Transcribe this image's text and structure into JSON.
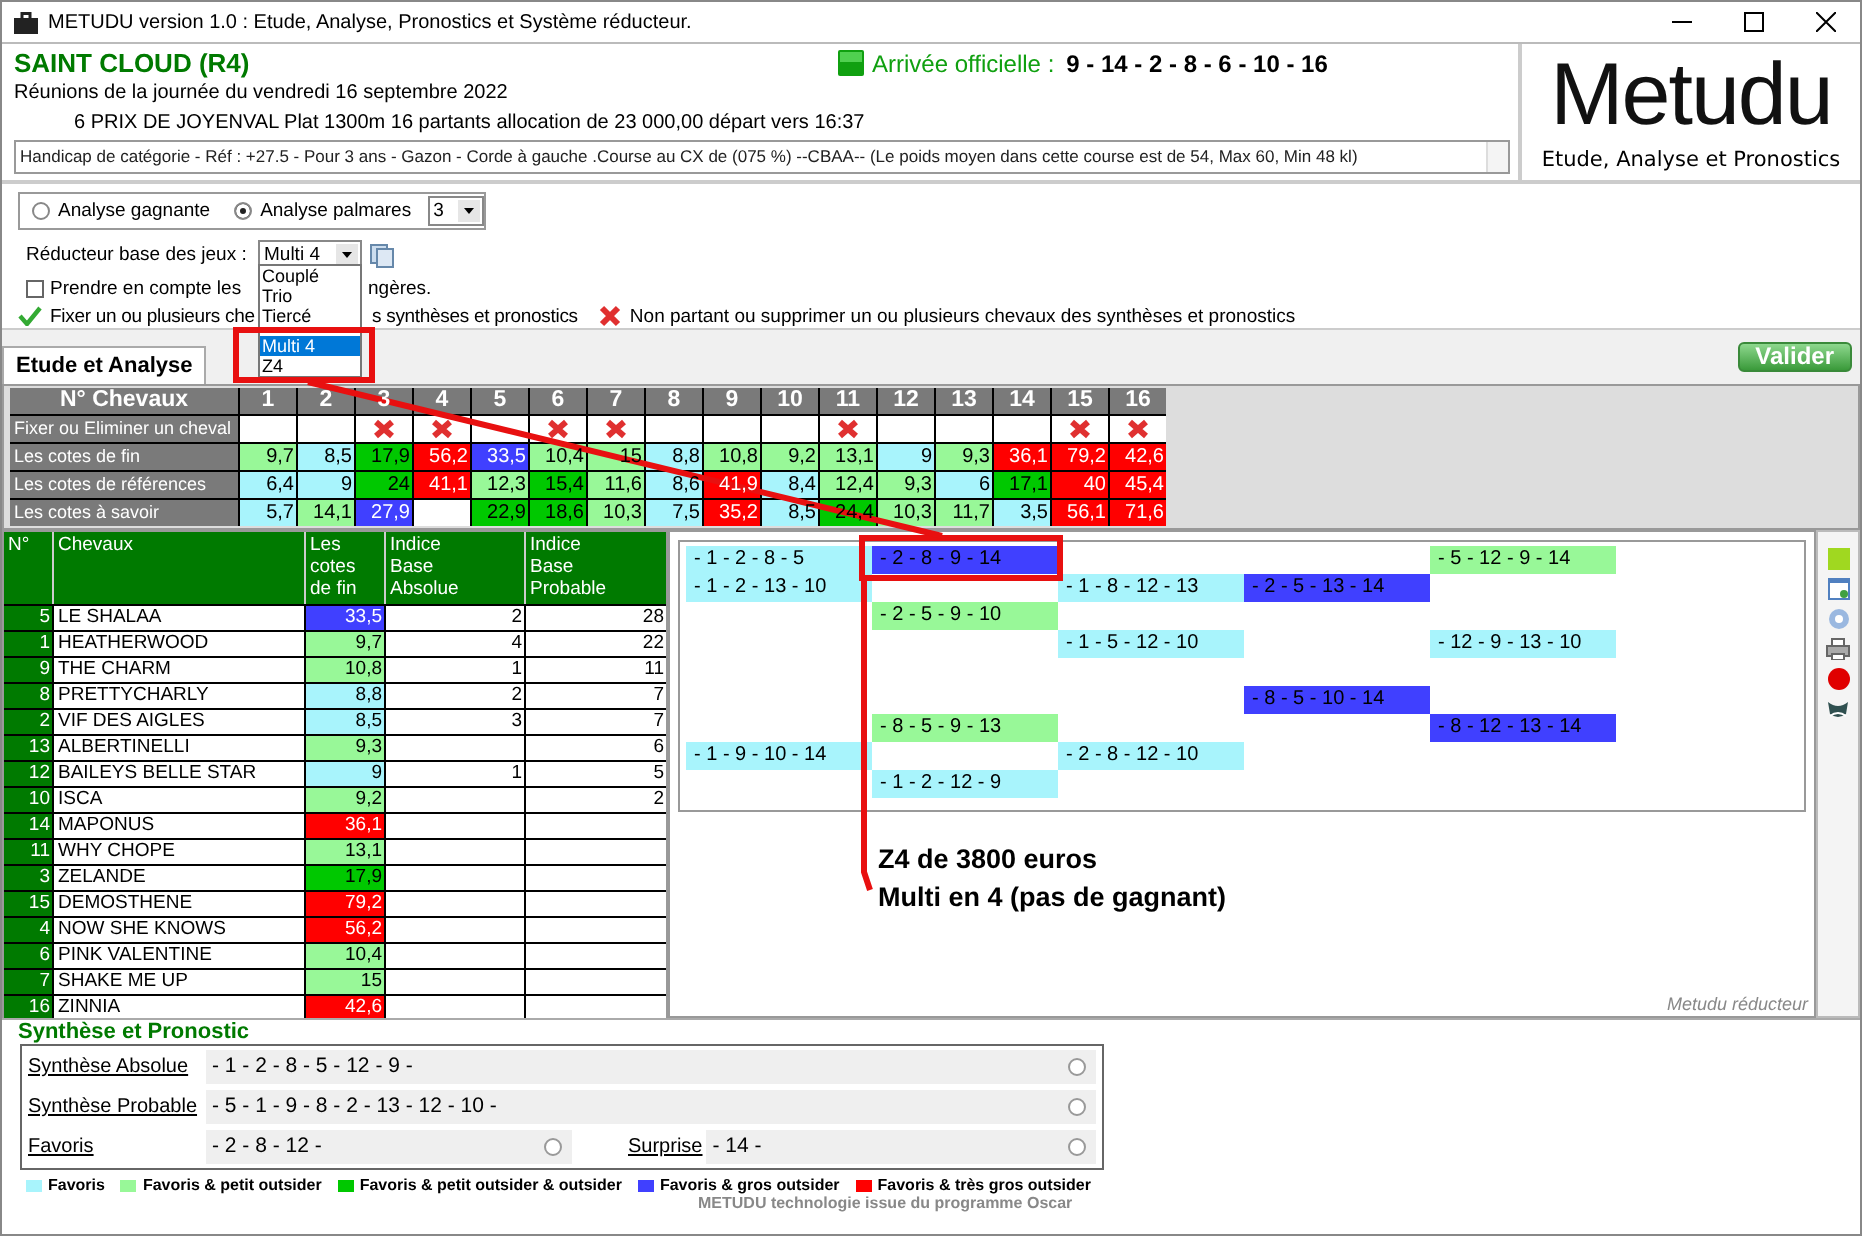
{
  "window": {
    "title": "METUDU version 1.0  : Etude, Analyse,  Pronostics et Système réducteur."
  },
  "race": {
    "venue": "SAINT CLOUD (R4)",
    "date_line": "Réunions de la journée du vendredi 16 septembre 2022",
    "race_line": "6 PRIX DE JOYENVAL Plat 1300m 16 partants allocation de 23 000,00 départ vers 16:37",
    "conditions": "Handicap de catégorie - Réf : +27.5 - Pour 3 ans - Gazon - Corde à gauche .Course au CX de (075 %)  --CBAA--  (Le poids moyen dans cette course est de 54, Max 60, Min 48 kl)",
    "arrival_label": "Arrivée officielle :",
    "arrival": "9 - 14 - 2 - 8 - 6 - 10 - 16"
  },
  "logo": {
    "name": "Metudu",
    "tagline": "Etude, Analyse et Pronostics"
  },
  "analysis_options": [
    {
      "label": "Analyse gagnante",
      "selected": false
    },
    {
      "label": "Analyse palmares",
      "selected": true
    }
  ],
  "palmares_count": "3",
  "reducer": {
    "label": "Réducteur base des jeux :",
    "value": "Multi 4",
    "options": [
      {
        "label": "Couplé",
        "selected": false
      },
      {
        "label": "Trio",
        "selected": false
      },
      {
        "label": "Tiercé",
        "selected": false
      },
      {
        "label": "Multi 4",
        "selected": true
      },
      {
        "label": "Z4",
        "selected": false
      }
    ]
  },
  "foreign_checkbox": {
    "label_before": "Prendre en compte les",
    "label_after": "ngères.",
    "checked": false
  },
  "fix_hint": {
    "before": "Fixer un ou plusieurs che",
    "after": "s synthèses et pronostics"
  },
  "remove_hint": "Non partant ou supprimer un ou plusieurs chevaux des synthèses et pronostics",
  "tabs": [
    {
      "label": "Etude et Analyse",
      "selected": true
    }
  ],
  "validate_button": "Valider",
  "odds_table": {
    "header": "N° Chevaux",
    "columns": [
      "1",
      "2",
      "3",
      "4",
      "5",
      "6",
      "7",
      "8",
      "9",
      "10",
      "11",
      "12",
      "13",
      "14",
      "15",
      "16"
    ],
    "fix_row": {
      "label": "Fixer ou Eliminer un cheval",
      "eliminated": [
        false,
        false,
        true,
        true,
        false,
        true,
        true,
        false,
        false,
        false,
        true,
        false,
        false,
        false,
        true,
        true
      ]
    },
    "rows": [
      {
        "label": "Les cotes de fin",
        "cells": [
          {
            "value": "9,7",
            "color": "#98f898"
          },
          {
            "value": "8,5",
            "color": "#a8f4fc"
          },
          {
            "value": "17,9",
            "color": "#00c800"
          },
          {
            "value": "56,2",
            "color": "#ff0000"
          },
          {
            "value": "33,5",
            "color": "#4040ff"
          },
          {
            "value": "10,4",
            "color": "#98f898"
          },
          {
            "value": "15",
            "color": "#98f898"
          },
          {
            "value": "8,8",
            "color": "#a8f4fc"
          },
          {
            "value": "10,8",
            "color": "#98f898"
          },
          {
            "value": "9,2",
            "color": "#98f898"
          },
          {
            "value": "13,1",
            "color": "#98f898"
          },
          {
            "value": "9",
            "color": "#a8f4fc"
          },
          {
            "value": "9,3",
            "color": "#98f898"
          },
          {
            "value": "36,1",
            "color": "#ff0000"
          },
          {
            "value": "79,2",
            "color": "#ff0000"
          },
          {
            "value": "42,6",
            "color": "#ff0000"
          }
        ]
      },
      {
        "label": "Les cotes de références",
        "cells": [
          {
            "value": "6,4",
            "color": "#a8f4fc"
          },
          {
            "value": "9",
            "color": "#a8f4fc"
          },
          {
            "value": "24",
            "color": "#00c800"
          },
          {
            "value": "41,1",
            "color": "#ff0000"
          },
          {
            "value": "12,3",
            "color": "#98f898"
          },
          {
            "value": "15,4",
            "color": "#00c800"
          },
          {
            "value": "11,6",
            "color": "#98f898"
          },
          {
            "value": "8,6",
            "color": "#a8f4fc"
          },
          {
            "value": "41,9",
            "color": "#ff0000"
          },
          {
            "value": "8,4",
            "color": "#a8f4fc"
          },
          {
            "value": "12,4",
            "color": "#98f898"
          },
          {
            "value": "9,3",
            "color": "#98f898"
          },
          {
            "value": "6",
            "color": "#a8f4fc"
          },
          {
            "value": "17,1",
            "color": "#00c800"
          },
          {
            "value": "40",
            "color": "#ff0000"
          },
          {
            "value": "45,4",
            "color": "#ff0000"
          }
        ]
      },
      {
        "label": "Les cotes à savoir",
        "cells": [
          {
            "value": "5,7",
            "color": "#a8f4fc"
          },
          {
            "value": "14,1",
            "color": "#98f898"
          },
          {
            "value": "27,9",
            "color": "#4040ff"
          },
          {
            "color": "#ffffff"
          },
          {
            "value": "22,9",
            "color": "#00c800"
          },
          {
            "value": "18,6",
            "color": "#00c800"
          },
          {
            "value": "10,3",
            "color": "#98f898"
          },
          {
            "value": "7,5",
            "color": "#a8f4fc"
          },
          {
            "value": "35,2",
            "color": "#ff0000"
          },
          {
            "value": "8,5",
            "color": "#a8f4fc"
          },
          {
            "value": "24,4",
            "color": "#00c800"
          },
          {
            "value": "10,3",
            "color": "#98f898"
          },
          {
            "value": "11,7",
            "color": "#98f898"
          },
          {
            "value": "3,5",
            "color": "#a8f4fc"
          },
          {
            "value": "56,1",
            "color": "#ff0000"
          },
          {
            "value": "71,6",
            "color": "#ff0000"
          }
        ]
      }
    ]
  },
  "horse_table": {
    "columns": [
      "N°",
      "Chevaux",
      "Les cotes de fin",
      "Indice Base Absolue",
      "Indice Base Probable"
    ],
    "rows": [
      {
        "num": "5",
        "name": "LE SHALAA",
        "odds": "33,5",
        "color": "#4040ff",
        "absolue": "2",
        "probable": "28"
      },
      {
        "num": "1",
        "name": "HEATHERWOOD",
        "odds": "9,7",
        "color": "#98f898",
        "absolue": "4",
        "probable": "22"
      },
      {
        "num": "9",
        "name": "THE CHARM",
        "odds": "10,8",
        "color": "#98f898",
        "absolue": "1",
        "probable": "11"
      },
      {
        "num": "8",
        "name": "PRETTYCHARLY",
        "odds": "8,8",
        "color": "#a8f4fc",
        "absolue": "2",
        "probable": "7"
      },
      {
        "num": "2",
        "name": "VIF DES AIGLES",
        "odds": "8,5",
        "color": "#a8f4fc",
        "absolue": "3",
        "probable": "7"
      },
      {
        "num": "13",
        "name": "ALBERTINELLI",
        "odds": "9,3",
        "color": "#98f898",
        "probable": "6"
      },
      {
        "num": "12",
        "name": "BAILEYS BELLE STAR",
        "odds": "9",
        "color": "#a8f4fc",
        "absolue": "1",
        "probable": "5"
      },
      {
        "num": "10",
        "name": "ISCA",
        "odds": "9,2",
        "color": "#98f898",
        "probable": "2"
      },
      {
        "num": "14",
        "name": "MAPONUS",
        "odds": "36,1",
        "color": "#ff0000"
      },
      {
        "num": "11",
        "name": "WHY CHOPE",
        "odds": "13,1",
        "color": "#98f898"
      },
      {
        "num": "3",
        "name": "ZELANDE",
        "odds": "17,9",
        "color": "#00c800"
      },
      {
        "num": "15",
        "name": "DEMOSTHENE",
        "odds": "79,2",
        "color": "#ff0000"
      },
      {
        "num": "4",
        "name": "NOW SHE KNOWS",
        "odds": "56,2",
        "color": "#ff0000"
      },
      {
        "num": "6",
        "name": "PINK VALENTINE",
        "odds": "10,4",
        "color": "#98f898"
      },
      {
        "num": "7",
        "name": "SHAKE ME UP",
        "odds": "15",
        "color": "#98f898"
      },
      {
        "num": "16",
        "name": "ZINNIA",
        "odds": "42,6",
        "color": "#ff0000"
      }
    ]
  },
  "combinations": [
    [
      {
        "kind": "combo",
        "text": "- 1 - 2 - 8 - 5",
        "color": "#a8f4fc"
      },
      {
        "kind": "combo",
        "text": "- 2 - 8 - 9 - 14",
        "color": "#4040ff"
      },
      {
        "kind": "empty"
      },
      {
        "kind": "empty"
      },
      {
        "kind": "combo",
        "text": "- 5 - 12 - 9 - 14",
        "color": "#98f898"
      }
    ],
    [
      {
        "kind": "combo",
        "text": "- 1 - 2 - 13 - 10",
        "color": "#a8f4fc"
      },
      {
        "kind": "empty"
      },
      {
        "kind": "combo",
        "text": "- 1 - 8 - 12 - 13",
        "color": "#a8f4fc"
      },
      {
        "kind": "combo",
        "text": "- 2 - 5 - 13 - 14",
        "color": "#4040ff"
      },
      {
        "kind": "empty"
      }
    ],
    [
      {
        "kind": "empty"
      },
      {
        "kind": "combo",
        "text": "- 2 - 5 - 9 - 10",
        "color": "#98f898"
      },
      {
        "kind": "empty"
      },
      {
        "kind": "empty"
      },
      {
        "kind": "empty"
      }
    ],
    [
      {
        "kind": "empty"
      },
      {
        "kind": "empty"
      },
      {
        "kind": "combo",
        "text": "- 1 - 5 - 12 - 10",
        "color": "#a8f4fc"
      },
      {
        "kind": "empty"
      },
      {
        "kind": "combo",
        "text": "- 12 - 9 - 13 - 10",
        "color": "#a8f4fc"
      }
    ],
    [
      {
        "kind": "empty"
      },
      {
        "kind": "empty"
      },
      {
        "kind": "empty"
      },
      {
        "kind": "empty"
      },
      {
        "kind": "empty"
      }
    ],
    [
      {
        "kind": "empty"
      },
      {
        "kind": "empty"
      },
      {
        "kind": "empty"
      },
      {
        "kind": "combo",
        "text": "- 8 - 5 - 10 - 14",
        "color": "#4040ff"
      },
      {
        "kind": "empty"
      }
    ],
    [
      {
        "kind": "empty"
      },
      {
        "kind": "combo",
        "text": "- 8 - 5 - 9 - 13",
        "color": "#98f898"
      },
      {
        "kind": "empty"
      },
      {
        "kind": "empty"
      },
      {
        "kind": "combo",
        "text": "- 8 - 12 - 13 - 14",
        "color": "#4040ff"
      }
    ],
    [
      {
        "kind": "combo",
        "text": "- 1 - 9 - 10 - 14",
        "color": "#a8f4fc"
      },
      {
        "kind": "empty"
      },
      {
        "kind": "combo",
        "text": "- 2 - 8 - 12 - 10",
        "color": "#a8f4fc"
      },
      {
        "kind": "empty"
      },
      {
        "kind": "empty"
      }
    ],
    [
      {
        "kind": "empty"
      },
      {
        "kind": "combo",
        "text": "- 1 - 2 - 12 - 9",
        "color": "#a8f4fc"
      },
      {
        "kind": "empty"
      },
      {
        "kind": "empty"
      },
      {
        "kind": "empty"
      }
    ]
  ],
  "annotation": [
    "Z4 de 3800 euros",
    "Multi en 4 (pas de gagnant)"
  ],
  "reducer_caption": "Metudu réducteur",
  "synthese": {
    "title": "Synthèse et Pronostic",
    "lines": [
      {
        "label": "Synthèse Absolue",
        "value": "- 1 - 2 - 8 - 5 - 12 - 9 -",
        "selected": false
      },
      {
        "label": "Synthèse Probable",
        "value": "- 5 - 1 - 9 - 8 - 2 - 13 - 12 - 10 -",
        "selected": false
      }
    ],
    "pair": [
      {
        "label": "Favoris",
        "value": "- 2 - 8 - 12 -",
        "selected": false
      },
      {
        "label": "Surprise",
        "value": "- 14 -",
        "selected": false
      }
    ]
  },
  "legend": [
    {
      "label": "Favoris",
      "color": "#a8f4fc"
    },
    {
      "label": "Favoris & petit outsider",
      "color": "#98f898"
    },
    {
      "label": "Favoris & petit outsider & outsider",
      "color": "#00c800"
    },
    {
      "label": "Favoris & gros outsider",
      "color": "#4040ff"
    },
    {
      "label": "Favoris & très gros outsider",
      "color": "#ff0000"
    }
  ],
  "footer": "METUDU technologie issue du programme Oscar"
}
